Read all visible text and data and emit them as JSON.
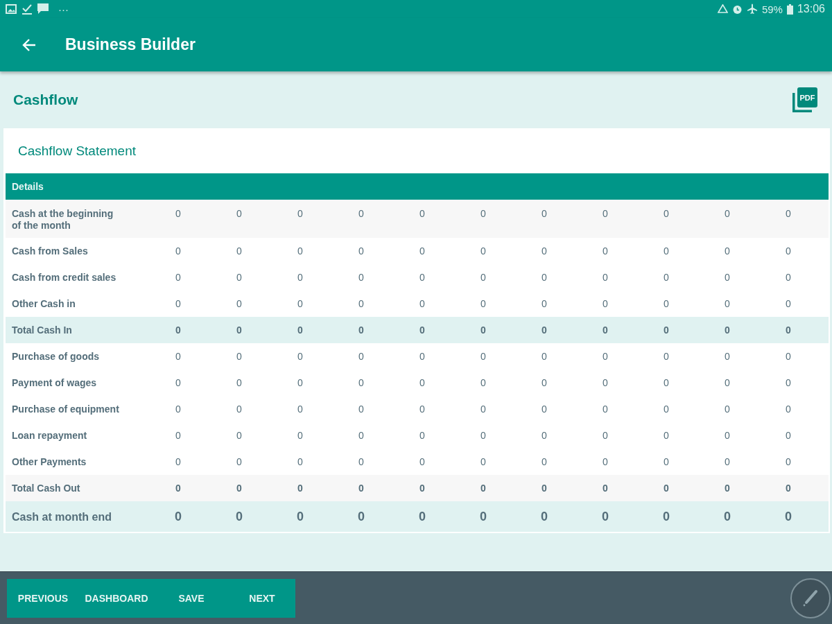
{
  "status_bar": {
    "more": "···",
    "battery": "59%",
    "time": "13:06"
  },
  "app_bar": {
    "title": "Business Builder"
  },
  "page": {
    "title": "Cashflow",
    "pdf_label": "PDF"
  },
  "card": {
    "title": "Cashflow Statement"
  },
  "table": {
    "columns": [
      "Details"
    ],
    "rows": [
      {
        "kind": "alt",
        "label": "Cash at the beginning of the month",
        "values": [
          "0",
          "0",
          "0",
          "0",
          "0",
          "0",
          "0",
          "0",
          "0",
          "0",
          "0"
        ]
      },
      {
        "kind": "plain",
        "label": "Cash from Sales",
        "values": [
          "0",
          "0",
          "0",
          "0",
          "0",
          "0",
          "0",
          "0",
          "0",
          "0",
          "0"
        ]
      },
      {
        "kind": "plain",
        "label": "Cash from credit sales",
        "values": [
          "0",
          "0",
          "0",
          "0",
          "0",
          "0",
          "0",
          "0",
          "0",
          "0",
          "0"
        ]
      },
      {
        "kind": "plain",
        "label": "Other Cash in",
        "values": [
          "0",
          "0",
          "0",
          "0",
          "0",
          "0",
          "0",
          "0",
          "0",
          "0",
          "0"
        ]
      },
      {
        "kind": "total",
        "label": "Total Cash In",
        "values": [
          "0",
          "0",
          "0",
          "0",
          "0",
          "0",
          "0",
          "0",
          "0",
          "0",
          "0"
        ]
      },
      {
        "kind": "plain",
        "label": "Purchase of goods",
        "values": [
          "0",
          "0",
          "0",
          "0",
          "0",
          "0",
          "0",
          "0",
          "0",
          "0",
          "0"
        ]
      },
      {
        "kind": "plain",
        "label": "Payment of wages",
        "values": [
          "0",
          "0",
          "0",
          "0",
          "0",
          "0",
          "0",
          "0",
          "0",
          "0",
          "0"
        ]
      },
      {
        "kind": "plain",
        "label": "Purchase of equipment",
        "values": [
          "0",
          "0",
          "0",
          "0",
          "0",
          "0",
          "0",
          "0",
          "0",
          "0",
          "0"
        ]
      },
      {
        "kind": "plain",
        "label": "Loan repayment",
        "values": [
          "0",
          "0",
          "0",
          "0",
          "0",
          "0",
          "0",
          "0",
          "0",
          "0",
          "0"
        ]
      },
      {
        "kind": "plain",
        "label": "Other Payments",
        "values": [
          "0",
          "0",
          "0",
          "0",
          "0",
          "0",
          "0",
          "0",
          "0",
          "0",
          "0"
        ]
      },
      {
        "kind": "total-alt",
        "label": "Total Cash Out",
        "values": [
          "0",
          "0",
          "0",
          "0",
          "0",
          "0",
          "0",
          "0",
          "0",
          "0",
          "0"
        ]
      },
      {
        "kind": "grand",
        "label": "Cash at month end",
        "values": [
          "0",
          "0",
          "0",
          "0",
          "0",
          "0",
          "0",
          "0",
          "0",
          "0",
          "0"
        ]
      }
    ]
  },
  "bottom_bar": {
    "buttons": [
      "PREVIOUS",
      "DASHBOARD",
      "SAVE",
      "NEXT"
    ]
  }
}
